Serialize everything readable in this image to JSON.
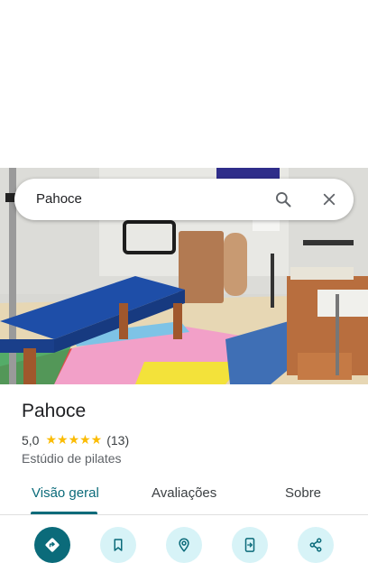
{
  "search": {
    "query": "Pahoce"
  },
  "place": {
    "name": "Pahoce",
    "rating": "5,0",
    "stars": "★★★★★",
    "review_count": "(13)",
    "category": "Estúdio de pilates"
  },
  "tabs": [
    {
      "label": "Visão geral",
      "active": true
    },
    {
      "label": "Avaliações",
      "active": false
    },
    {
      "label": "Sobre",
      "active": false
    }
  ],
  "actions": [
    {
      "icon": "directions-icon"
    },
    {
      "icon": "bookmark-icon"
    },
    {
      "icon": "nearby-icon"
    },
    {
      "icon": "send-to-phone-icon"
    },
    {
      "icon": "share-icon"
    }
  ],
  "colors": {
    "accent": "#0b6b7a",
    "action_bg": "#d7f3f7",
    "star": "#fbbc04"
  }
}
